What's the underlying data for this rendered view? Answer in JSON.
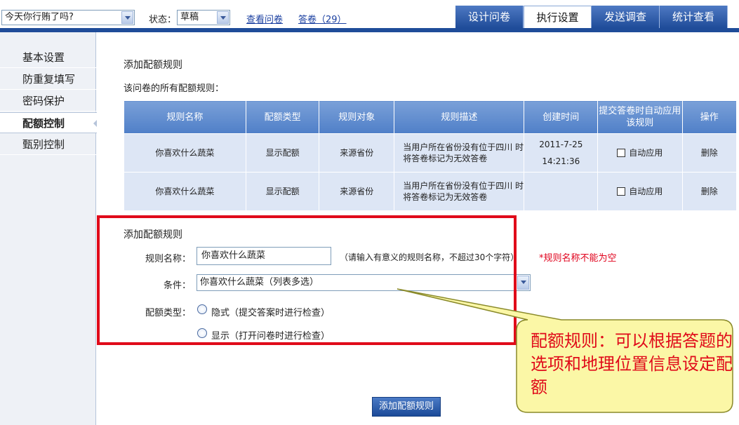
{
  "topbar": {
    "survey_select": "今天你行贿了吗?",
    "status_label": "状态：",
    "status_select": "草稿",
    "view_link": "查看问卷",
    "answers_link": "答卷（29）",
    "tabs": [
      {
        "label": "设计问卷"
      },
      {
        "label": "执行设置"
      },
      {
        "label": "发送调查"
      },
      {
        "label": "统计查看"
      }
    ]
  },
  "sidebar": {
    "items": [
      {
        "label": "基本设置"
      },
      {
        "label": "防重复填写"
      },
      {
        "label": "密码保护"
      },
      {
        "label": "配额控制"
      },
      {
        "label": "甄别控制"
      }
    ]
  },
  "main": {
    "heading": "添加配额规则",
    "subheading": "该问卷的所有配额规则：",
    "table": {
      "headers": [
        "规则名称",
        "配额类型",
        "规则对象",
        "规则描述",
        "创建时间",
        "提交答卷时自动应用该规则",
        "操作"
      ],
      "rows": [
        {
          "name": "你喜欢什么蔬菜",
          "type": "显示配额",
          "target": "来源省份",
          "desc": "当用户所在省份没有位于四川 时将答卷标记为无效答卷",
          "date": "2011-7-25",
          "time": "14:21:36",
          "auto": "自动应用",
          "action": "删除"
        },
        {
          "name": "你喜欢什么蔬菜",
          "type": "显示配额",
          "target": "来源省份",
          "desc": "当用户所在省份没有位于四川 时将答卷标记为无效答卷",
          "date": "",
          "time": "",
          "auto": "自动应用",
          "action": "删除"
        }
      ]
    },
    "form": {
      "title": "添加配额规则",
      "name_label": "规则名称：",
      "name_value": "你喜欢什么蔬菜",
      "name_hint": "（请输入有意义的规则名称，不超过30个字符）",
      "name_error": "*规则名称不能为空",
      "condition_label": "条件：",
      "condition_value": "你喜欢什么蔬菜（列表多选）",
      "type_label": "配额类型：",
      "option_hidden": "隐式（提交答案时进行检查）",
      "option_shown": "显示（打开问卷时进行检查）"
    },
    "submit_label": "添加配额规则"
  },
  "callout": {
    "text": "配额规则：可以根据答题的选项和地理位置信息设定配额"
  },
  "colors": {
    "tab_blue": "#1f4c99",
    "header_blue": "#5d89cc",
    "row_bg": "#dde6f5",
    "highlight_red": "#e00b1a",
    "callout_fill": "#fbf7a6"
  }
}
